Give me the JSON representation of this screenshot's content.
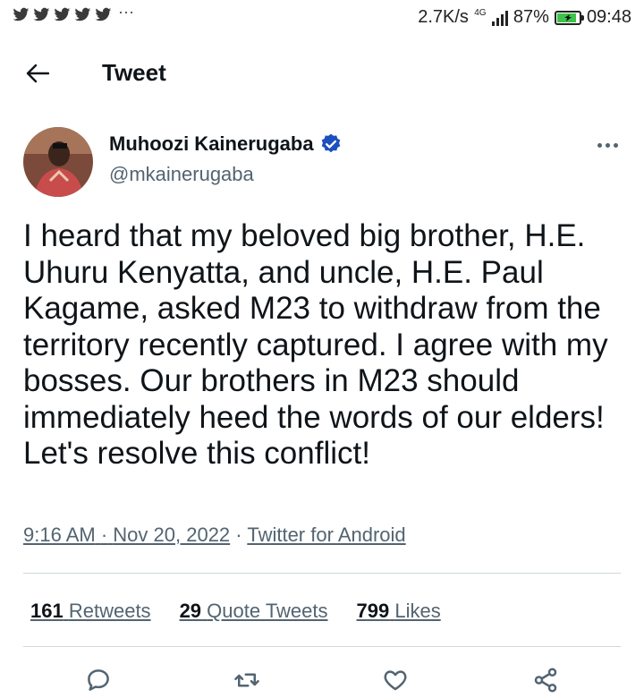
{
  "status_bar": {
    "notification_icons": [
      "twitter-bird-icon",
      "twitter-bird-icon",
      "twitter-bird-icon",
      "twitter-bird-icon",
      "twitter-bird-icon"
    ],
    "more_notifications": "···",
    "network_speed": "2.7K/s",
    "network_type": "4G",
    "battery_percent": "87%",
    "battery_level": 0.87,
    "time": "09:48"
  },
  "header": {
    "title": "Tweet"
  },
  "tweet": {
    "author_name": "Muhoozi Kainerugaba",
    "author_handle": "@mkainerugaba",
    "text": "I heard that my beloved big brother, H.E. Uhuru Kenyatta, and uncle, H.E. Paul Kagame, asked M23 to withdraw from the territory recently captured. I agree with my bosses. Our brothers in M23 should immediately heed the words of our elders! Let's resolve this conflict!",
    "time": "9:16 AM",
    "date": "Nov 20, 2022",
    "source": "Twitter for Android",
    "separator": "·"
  },
  "stats": {
    "retweets_count": "161",
    "retweets_label": "Retweets",
    "quote_count": "29",
    "quote_label": "Quote Tweets",
    "likes_count": "799",
    "likes_label": "Likes"
  },
  "colors": {
    "text": "#0f1419",
    "secondary": "#536471",
    "verified": "#1d4fbf",
    "divider": "#cfd9de"
  }
}
